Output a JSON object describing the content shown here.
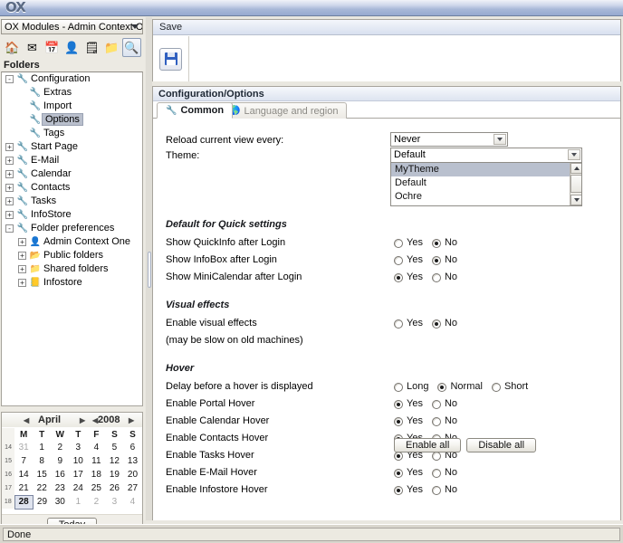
{
  "window": {
    "logo": "OX"
  },
  "sidebar": {
    "module_selector": {
      "value": "OX Modules - Admin Context One",
      "arrow_icon": "chevron-down-icon"
    },
    "module_icons": [
      {
        "name": "portal-icon",
        "glyph": "🏠",
        "selected": false
      },
      {
        "name": "email-icon",
        "glyph": "✉",
        "selected": false
      },
      {
        "name": "calendar-icon",
        "glyph": "📅",
        "selected": false
      },
      {
        "name": "contacts-icon",
        "glyph": "👤",
        "selected": false
      },
      {
        "name": "tasks-icon",
        "glyph": "🗒",
        "selected": false
      },
      {
        "name": "infostore-icon",
        "glyph": "📁",
        "selected": false
      },
      {
        "name": "configuration-icon",
        "glyph": "🔍",
        "selected": true
      }
    ],
    "folders_label": "Folders",
    "tree": [
      {
        "label": "Configuration",
        "indent": 0,
        "expander": "-",
        "icon": "🔧",
        "selected": false
      },
      {
        "label": "Extras",
        "indent": 1,
        "expander": "",
        "icon": "🔧",
        "selected": false
      },
      {
        "label": "Import",
        "indent": 1,
        "expander": "",
        "icon": "🔧",
        "selected": false
      },
      {
        "label": "Options",
        "indent": 1,
        "expander": "",
        "icon": "🔧",
        "selected": true
      },
      {
        "label": "Tags",
        "indent": 1,
        "expander": "",
        "icon": "🔧",
        "selected": false
      },
      {
        "label": "Start Page",
        "indent": 0,
        "expander": "+",
        "icon": "🔧",
        "selected": false
      },
      {
        "label": "E-Mail",
        "indent": 0,
        "expander": "+",
        "icon": "🔧",
        "selected": false
      },
      {
        "label": "Calendar",
        "indent": 0,
        "expander": "+",
        "icon": "🔧",
        "selected": false
      },
      {
        "label": "Contacts",
        "indent": 0,
        "expander": "+",
        "icon": "🔧",
        "selected": false
      },
      {
        "label": "Tasks",
        "indent": 0,
        "expander": "+",
        "icon": "🔧",
        "selected": false
      },
      {
        "label": "InfoStore",
        "indent": 0,
        "expander": "+",
        "icon": "🔧",
        "selected": false
      },
      {
        "label": "Folder preferences",
        "indent": 0,
        "expander": "-",
        "icon": "🔧",
        "selected": false
      },
      {
        "label": "Admin Context One",
        "indent": 1,
        "expander": "+",
        "icon": "👤",
        "selected": false
      },
      {
        "label": "Public folders",
        "indent": 1,
        "expander": "+",
        "icon": "📂",
        "selected": false
      },
      {
        "label": "Shared folders",
        "indent": 1,
        "expander": "+",
        "icon": "📁",
        "selected": false
      },
      {
        "label": "Infostore",
        "indent": 1,
        "expander": "+",
        "icon": "📒",
        "selected": false
      }
    ]
  },
  "minicalendar": {
    "month": "April",
    "year": "2008",
    "prev_month_icon": "left-arrow-icon",
    "next_month_icon": "right-arrow-icon",
    "prev_year_icon": "left-arrow-icon",
    "next_year_icon": "right-arrow-icon",
    "weekday_headers": [
      "M",
      "T",
      "W",
      "T",
      "F",
      "S",
      "S"
    ],
    "week_numbers": [
      "14",
      "15",
      "16",
      "17",
      "18"
    ],
    "weeks": [
      [
        {
          "d": "31",
          "out": true
        },
        {
          "d": "1"
        },
        {
          "d": "2"
        },
        {
          "d": "3"
        },
        {
          "d": "4"
        },
        {
          "d": "5"
        },
        {
          "d": "6"
        }
      ],
      [
        {
          "d": "7"
        },
        {
          "d": "8"
        },
        {
          "d": "9"
        },
        {
          "d": "10"
        },
        {
          "d": "11"
        },
        {
          "d": "12"
        },
        {
          "d": "13"
        }
      ],
      [
        {
          "d": "14"
        },
        {
          "d": "15"
        },
        {
          "d": "16"
        },
        {
          "d": "17"
        },
        {
          "d": "18"
        },
        {
          "d": "19"
        },
        {
          "d": "20"
        }
      ],
      [
        {
          "d": "21"
        },
        {
          "d": "22"
        },
        {
          "d": "23"
        },
        {
          "d": "24"
        },
        {
          "d": "25"
        },
        {
          "d": "26"
        },
        {
          "d": "27"
        }
      ],
      [
        {
          "d": "28",
          "today": true
        },
        {
          "d": "29"
        },
        {
          "d": "30"
        },
        {
          "d": "1",
          "out": true
        },
        {
          "d": "2",
          "out": true
        },
        {
          "d": "3",
          "out": true
        },
        {
          "d": "4",
          "out": true
        }
      ]
    ],
    "today_button": "Today"
  },
  "toolbar": {
    "tab_label": "Save",
    "save_icon": "floppy-disk-icon"
  },
  "main": {
    "panel_title": "Configuration/Options",
    "tabs": [
      {
        "label": "Common",
        "icon": "wrench-icon",
        "active": true
      },
      {
        "label": "Language and region",
        "icon": "globe-icon",
        "active": false
      }
    ],
    "fields": {
      "reload_label": "Reload current view every:",
      "reload_value": "Never",
      "theme_label": "Theme:",
      "theme_value": "Default",
      "theme_options": [
        "MyTheme",
        "Default",
        "Ochre"
      ],
      "theme_selected": "MyTheme"
    },
    "sections": [
      {
        "heading": "Default for Quick settings",
        "rows": [
          {
            "label": "Show QuickInfo after Login",
            "options": [
              "Yes",
              "No"
            ],
            "selected": "No"
          },
          {
            "label": "Show InfoBox after Login",
            "options": [
              "Yes",
              "No"
            ],
            "selected": "No"
          },
          {
            "label": "Show MiniCalendar after Login",
            "options": [
              "Yes",
              "No"
            ],
            "selected": "Yes"
          }
        ]
      },
      {
        "heading": "Visual effects",
        "rows": [
          {
            "label": "Enable visual effects",
            "options": [
              "Yes",
              "No"
            ],
            "selected": "No"
          },
          {
            "label": "(may be slow on old machines)",
            "options": [],
            "selected": ""
          }
        ]
      },
      {
        "heading": "Hover",
        "rows": [
          {
            "label": "Delay before a hover is displayed",
            "options": [
              "Long",
              "Normal",
              "Short"
            ],
            "selected": "Normal"
          },
          {
            "label": "Enable Portal Hover",
            "options": [
              "Yes",
              "No"
            ],
            "selected": "Yes"
          },
          {
            "label": "Enable Calendar Hover",
            "options": [
              "Yes",
              "No"
            ],
            "selected": "Yes"
          },
          {
            "label": "Enable Contacts Hover",
            "options": [
              "Yes",
              "No"
            ],
            "selected": "Yes"
          },
          {
            "label": "Enable Tasks Hover",
            "options": [
              "Yes",
              "No"
            ],
            "selected": "Yes"
          },
          {
            "label": "Enable E-Mail Hover",
            "options": [
              "Yes",
              "No"
            ],
            "selected": "Yes"
          },
          {
            "label": "Enable Infostore Hover",
            "options": [
              "Yes",
              "No"
            ],
            "selected": "Yes"
          }
        ]
      }
    ],
    "buttons": {
      "enable_all": "Enable all",
      "disable_all": "Disable all"
    }
  },
  "statusbar": {
    "text": "Done"
  },
  "colors": {
    "titlebar_blue": "#a8b8d8",
    "selection": "#b9c0ce",
    "panel_header": "#dde4f0",
    "save_icon_blue": "#2f5fc0",
    "chrome_bg": "#e9e7e0"
  }
}
